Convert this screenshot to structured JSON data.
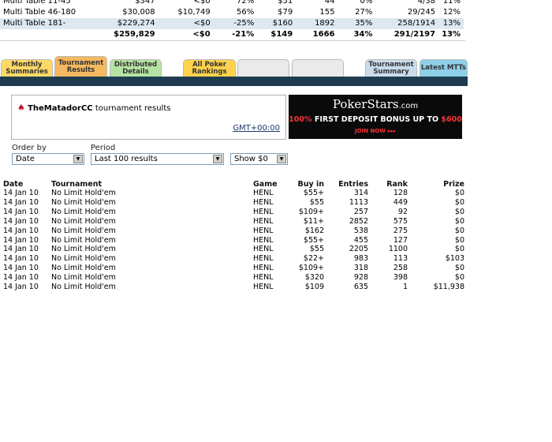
{
  "summary": {
    "rows": [
      {
        "name": "Multi Table 11-45",
        "c1": "$347",
        "c2": "<$0",
        "c3": "72%",
        "c4": "$51",
        "c5": "44",
        "c6": "0%",
        "c7": "4/38",
        "c8": "11%",
        "hl": false,
        "total": false
      },
      {
        "name": "Multi Table 46-180",
        "c1": "$30,008",
        "c2": "$10,749",
        "c3": "56%",
        "c4": "$79",
        "c5": "155",
        "c6": "27%",
        "c7": "29/245",
        "c8": "12%",
        "hl": false,
        "total": false
      },
      {
        "name": "Multi Table 181-",
        "c1": "$229,274",
        "c2": "<$0",
        "c3": "-25%",
        "c4": "$160",
        "c5": "1892",
        "c6": "35%",
        "c7": "258/1914",
        "c8": "13%",
        "hl": true,
        "total": false
      },
      {
        "name": "",
        "c1": "$259,829",
        "c2": "<$0",
        "c3": "-21%",
        "c4": "$149",
        "c5": "1666",
        "c6": "34%",
        "c7": "291/2197",
        "c8": "13%",
        "hl": false,
        "total": true
      }
    ]
  },
  "tabs": [
    {
      "label": "Monthly Summaries",
      "color": "#ffd966"
    },
    {
      "label": "Tournament Results",
      "color": "#f4b860"
    },
    {
      "label": "Distributed Details",
      "color": "#b5e3a2"
    },
    {
      "label": "",
      "color": "#ffffff"
    },
    {
      "label": "All Poker Rankings",
      "color": "#ffd24d"
    },
    {
      "label": "",
      "color": "#eaeaea"
    },
    {
      "label": "",
      "color": "#eaeaea"
    },
    {
      "label": "Tournament Summary",
      "color": "#c9dcec"
    },
    {
      "label": "Latest MTTs",
      "color": "#8ed0e8"
    }
  ],
  "user": {
    "name": "TheMatadorCC",
    "suffix": " tournament results",
    "timezone": "GMT+00:00"
  },
  "banner": {
    "logo_main": "PokerStars",
    "logo_suffix": ".com",
    "promo_prefix": "100%",
    "promo_text": " FIRST DEPOSIT BONUS UP TO ",
    "promo_amount": "$600",
    "join": "JOIN NOW ▸▸▸"
  },
  "filters": {
    "order_label": "Order by",
    "order_value": "Date",
    "period_label": "Period",
    "period_value": "Last 100 results",
    "show_value": "Show $0"
  },
  "results": {
    "headers": {
      "date": "Date",
      "tournament": "Tournament",
      "game": "Game",
      "buyin": "Buy in",
      "entries": "Entries",
      "rank": "Rank",
      "prize": "Prize"
    },
    "rows": [
      {
        "date": "14 Jan 10",
        "tournament": "No Limit Hold'em",
        "game": "HENL",
        "buyin": "$55+",
        "entries": "314",
        "rank": "128",
        "prize": "$0"
      },
      {
        "date": "14 Jan 10",
        "tournament": "No Limit Hold'em",
        "game": "HENL",
        "buyin": "$55",
        "entries": "1113",
        "rank": "449",
        "prize": "$0"
      },
      {
        "date": "14 Jan 10",
        "tournament": "No Limit Hold'em",
        "game": "HENL",
        "buyin": "$109+",
        "entries": "257",
        "rank": "92",
        "prize": "$0"
      },
      {
        "date": "14 Jan 10",
        "tournament": "No Limit Hold'em",
        "game": "HENL",
        "buyin": "$11+",
        "entries": "2852",
        "rank": "575",
        "prize": "$0"
      },
      {
        "date": "14 Jan 10",
        "tournament": "No Limit Hold'em",
        "game": "HENL",
        "buyin": "$162",
        "entries": "538",
        "rank": "275",
        "prize": "$0"
      },
      {
        "date": "14 Jan 10",
        "tournament": "No Limit Hold'em",
        "game": "HENL",
        "buyin": "$55+",
        "entries": "455",
        "rank": "127",
        "prize": "$0"
      },
      {
        "date": "14 Jan 10",
        "tournament": "No Limit Hold'em",
        "game": "HENL",
        "buyin": "$55",
        "entries": "2205",
        "rank": "1100",
        "prize": "$0"
      },
      {
        "date": "14 Jan 10",
        "tournament": "No Limit Hold'em",
        "game": "HENL",
        "buyin": "$22+",
        "entries": "983",
        "rank": "113",
        "prize": "$103"
      },
      {
        "date": "14 Jan 10",
        "tournament": "No Limit Hold'em",
        "game": "HENL",
        "buyin": "$109+",
        "entries": "318",
        "rank": "258",
        "prize": "$0"
      },
      {
        "date": "14 Jan 10",
        "tournament": "No Limit Hold'em",
        "game": "HENL",
        "buyin": "$320",
        "entries": "928",
        "rank": "398",
        "prize": "$0"
      },
      {
        "date": "14 Jan 10",
        "tournament": "No Limit Hold'em",
        "game": "HENL",
        "buyin": "$109",
        "entries": "635",
        "rank": "1",
        "prize": "$11,938"
      }
    ]
  }
}
